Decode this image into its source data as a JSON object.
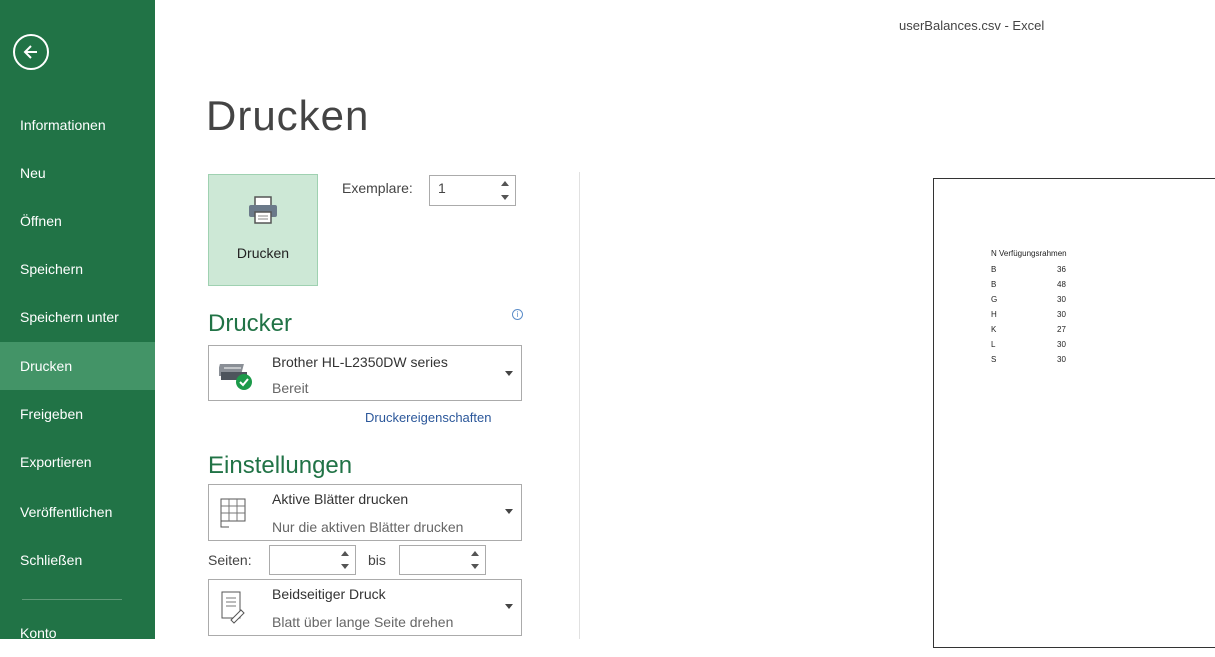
{
  "window": {
    "title": "userBalances.csv - Excel"
  },
  "sidebar": {
    "items": [
      {
        "label": "Informationen"
      },
      {
        "label": "Neu"
      },
      {
        "label": "Öffnen"
      },
      {
        "label": "Speichern"
      },
      {
        "label": "Speichern unter"
      },
      {
        "label": "Drucken"
      },
      {
        "label": "Freigeben"
      },
      {
        "label": "Exportieren"
      },
      {
        "label": "Veröffentlichen"
      },
      {
        "label": "Schließen"
      },
      {
        "label": "Konto"
      }
    ],
    "active": "Drucken"
  },
  "page": {
    "title": "Drucken"
  },
  "print": {
    "button_label": "Drucken",
    "copies_label": "Exemplare:",
    "copies_value": "1"
  },
  "printer": {
    "heading": "Drucker",
    "name": "Brother HL-L2350DW series",
    "status": "Bereit",
    "properties_link": "Druckereigenschaften"
  },
  "settings": {
    "heading": "Einstellungen",
    "scope_title": "Aktive Blätter drucken",
    "scope_desc": "Nur die aktiven Blätter drucken",
    "pages_label": "Seiten:",
    "pages_to_label": "bis",
    "pages_from": "",
    "pages_to": "",
    "duplex_title": "Beidseitiger Druck",
    "duplex_desc": "Blatt über lange Seite drehen"
  },
  "preview": {
    "header": "N Verfügungsrahmen",
    "rows": [
      {
        "c1": "B",
        "c2": "36"
      },
      {
        "c1": "B",
        "c2": "48"
      },
      {
        "c1": "G",
        "c2": "30"
      },
      {
        "c1": "H",
        "c2": "30"
      },
      {
        "c1": "K",
        "c2": "27"
      },
      {
        "c1": "L",
        "c2": "30"
      },
      {
        "c1": "S",
        "c2": "30"
      }
    ]
  },
  "colors": {
    "accent": "#217346",
    "active_item": "#439467",
    "print_button": "#cde8d6",
    "link": "#2b579a"
  }
}
